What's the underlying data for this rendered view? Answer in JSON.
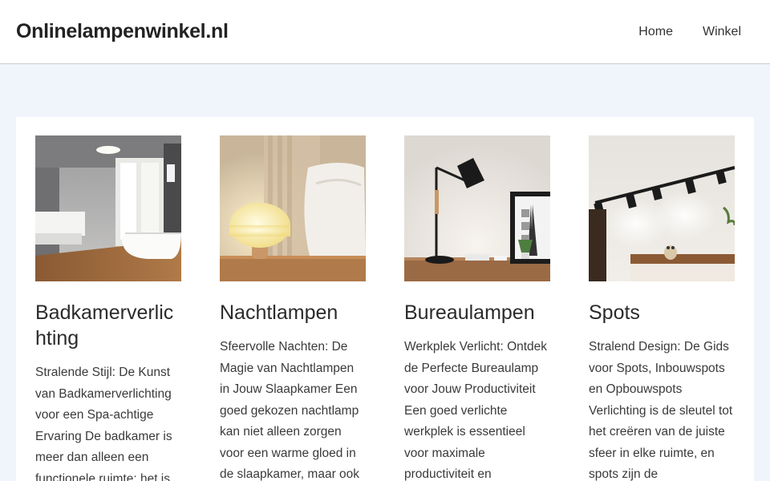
{
  "site": {
    "title": "Onlinelampenwinkel.nl"
  },
  "nav": {
    "items": [
      {
        "label": "Home"
      },
      {
        "label": "Winkel"
      }
    ]
  },
  "cards": [
    {
      "title": "Badkamerverlichting",
      "excerpt": "Stralende Stijl: De Kunst van Badkamerverlichting voor een Spa-achtige Ervaring De badkamer is meer dan alleen een functionele ruimte; het is"
    },
    {
      "title": "Nachtlampen",
      "excerpt": "Sfeervolle Nachten: De Magie van Nachtlampen in Jouw Slaapkamer Een goed gekozen nachtlamp kan niet alleen zorgen voor een warme gloed in de slaapkamer, maar ook"
    },
    {
      "title": "Bureaulampen",
      "excerpt": "Werkplek Verlicht: Ontdek de Perfecte Bureaulamp voor Jouw Productiviteit Een goed verlichte werkplek is essentieel voor maximale productiviteit en"
    },
    {
      "title": "Spots",
      "excerpt": "Stralend Design: De Gids voor Spots, Inbouwspots en Opbouwspots Verlichting is de sleutel tot het creëren van de juiste sfeer in elke ruimte, en spots zijn de"
    }
  ]
}
